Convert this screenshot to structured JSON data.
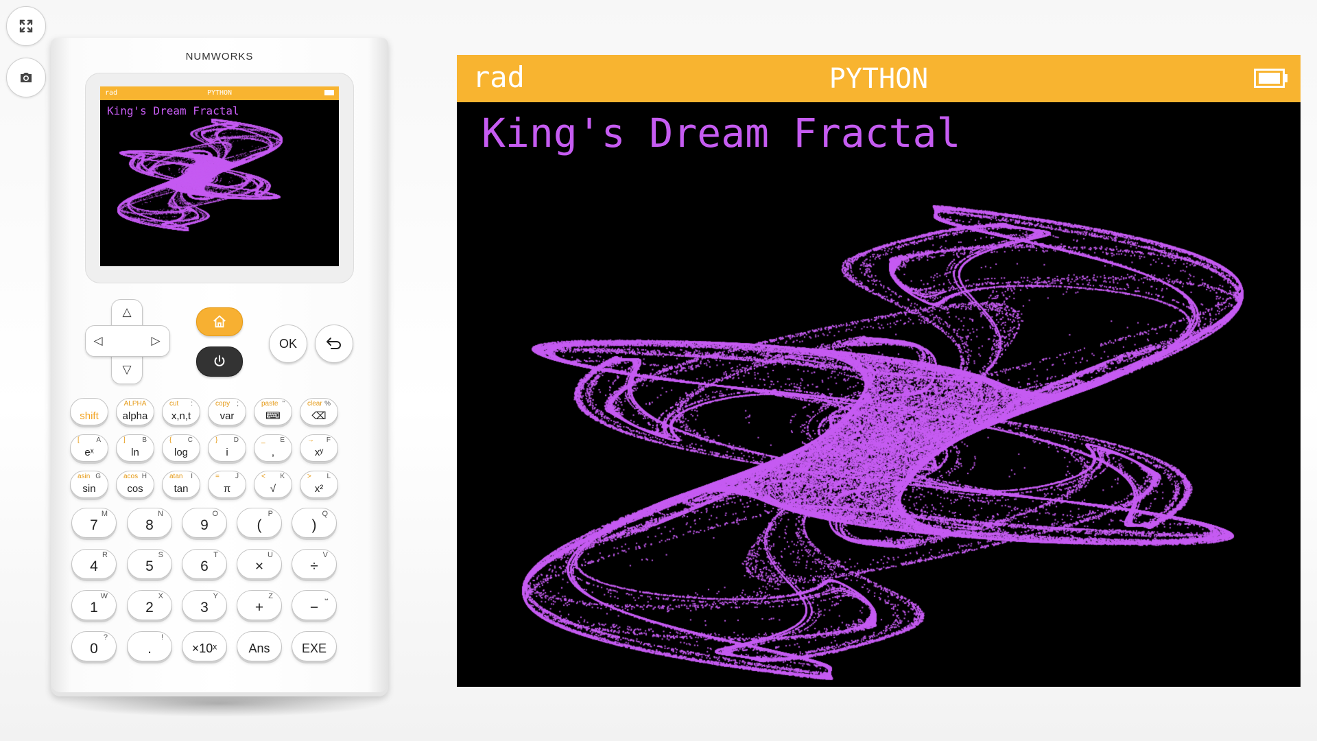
{
  "toolbar": {
    "fullscreen_icon": "fullscreen-icon",
    "screenshot_icon": "camera-icon"
  },
  "calculator": {
    "brand": "NUMWORKS",
    "status": {
      "angle_mode": "rad",
      "app": "PYTHON",
      "battery_icon": "battery-icon"
    },
    "output_title": "King's Dream Fractal",
    "nav": {
      "ok": "OK",
      "home_icon": "home-icon",
      "power_icon": "power-icon",
      "back_icon": "back-arrow-icon",
      "up": "△",
      "down": "▽",
      "left": "◁",
      "right": "▷"
    },
    "colors": {
      "accent": "#f8b430",
      "fractal": "#c65cf2",
      "screen_bg": "#000000"
    },
    "func_keys": [
      [
        {
          "main": "shift",
          "sec": "",
          "alpha": ""
        },
        {
          "main": "alpha",
          "sec": "ALPHA",
          "alpha": ""
        },
        {
          "main": "x,n,t",
          "sec": "cut",
          "alpha": ":"
        },
        {
          "main": "var",
          "sec": "copy",
          "alpha": ";"
        },
        {
          "main": "⌨",
          "sec": "paste",
          "alpha": "\""
        },
        {
          "main": "⌫",
          "sec": "clear",
          "alpha": "%"
        }
      ],
      [
        {
          "main": "eˣ",
          "sec": "[",
          "alpha": "A"
        },
        {
          "main": "ln",
          "sec": "]",
          "alpha": "B"
        },
        {
          "main": "log",
          "sec": "{",
          "alpha": "C"
        },
        {
          "main": "i",
          "sec": "}",
          "alpha": "D"
        },
        {
          "main": ",",
          "sec": "_",
          "alpha": "E"
        },
        {
          "main": "xʸ",
          "sec": "→",
          "alpha": "F"
        }
      ],
      [
        {
          "main": "sin",
          "sec": "asin",
          "alpha": "G"
        },
        {
          "main": "cos",
          "sec": "acos",
          "alpha": "H"
        },
        {
          "main": "tan",
          "sec": "atan",
          "alpha": "I"
        },
        {
          "main": "π",
          "sec": "=",
          "alpha": "J"
        },
        {
          "main": "√",
          "sec": "<",
          "alpha": "K"
        },
        {
          "main": "x²",
          "sec": ">",
          "alpha": "L"
        }
      ]
    ],
    "num_keys": [
      [
        {
          "main": "7",
          "alpha": "M"
        },
        {
          "main": "8",
          "alpha": "N"
        },
        {
          "main": "9",
          "alpha": "O"
        },
        {
          "main": "(",
          "alpha": "P"
        },
        {
          "main": ")",
          "alpha": "Q"
        }
      ],
      [
        {
          "main": "4",
          "alpha": "R"
        },
        {
          "main": "5",
          "alpha": "S"
        },
        {
          "main": "6",
          "alpha": "T"
        },
        {
          "main": "×",
          "alpha": "U"
        },
        {
          "main": "÷",
          "alpha": "V"
        }
      ],
      [
        {
          "main": "1",
          "alpha": "W"
        },
        {
          "main": "2",
          "alpha": "X"
        },
        {
          "main": "3",
          "alpha": "Y"
        },
        {
          "main": "+",
          "alpha": "Z"
        },
        {
          "main": "−",
          "alpha": "⎵"
        }
      ],
      [
        {
          "main": "0",
          "alpha": "?"
        },
        {
          "main": ".",
          "alpha": "!"
        },
        {
          "main": "×10ˣ",
          "alpha": ""
        },
        {
          "main": "Ans",
          "alpha": ""
        },
        {
          "main": "EXE",
          "alpha": ""
        }
      ]
    ]
  }
}
